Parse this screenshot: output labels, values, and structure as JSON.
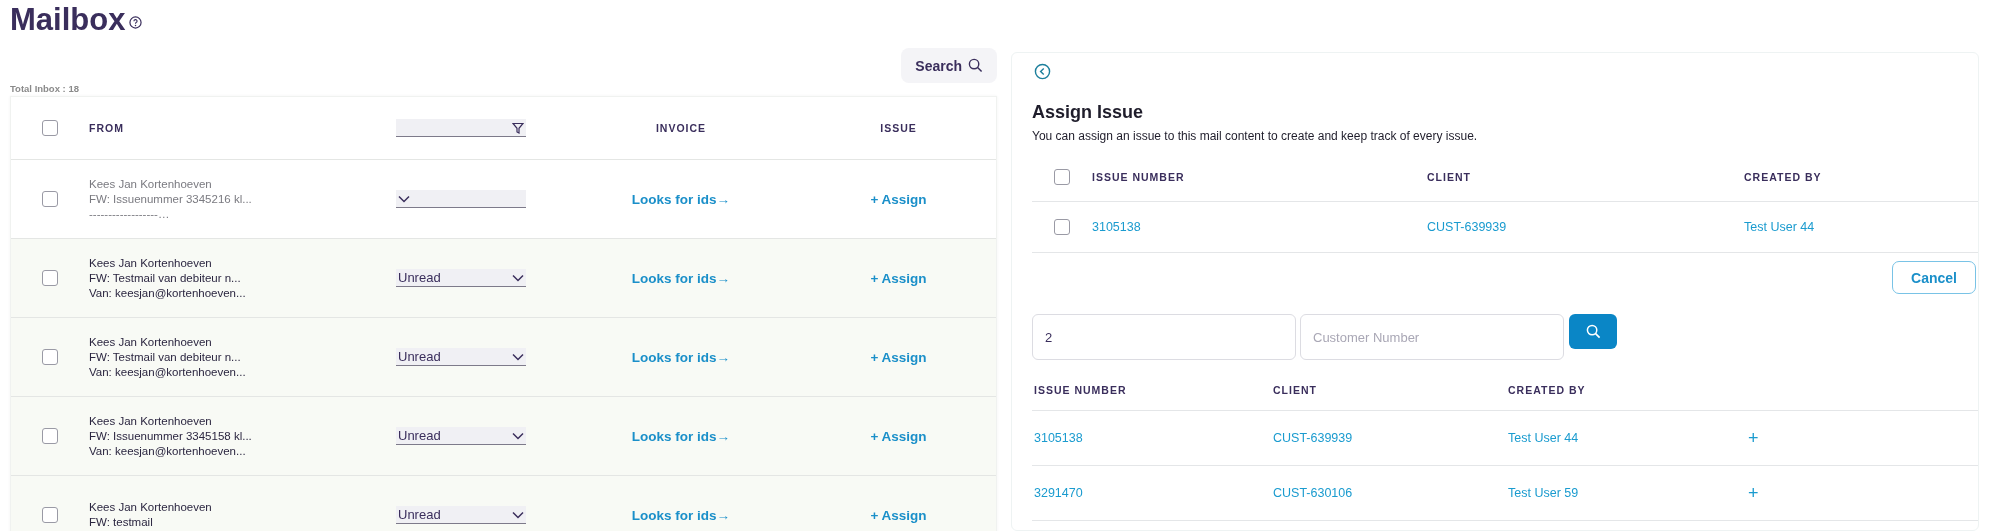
{
  "page": {
    "title": "Mailbox",
    "search_button": "Search",
    "total": "Total Inbox : 18"
  },
  "mail_table": {
    "header_checked": false,
    "columns": [
      "FROM",
      "INVOICE",
      "ISSUE"
    ],
    "rows": [
      {
        "checked": false,
        "muted": true,
        "sender": "Kees Jan Kortenhoeven",
        "subject": "FW: Issuenummer 3345216 kl...",
        "preview": "------------------…",
        "invoice_link": "Looks for ids→",
        "issue_link": "+ Assign"
      },
      {
        "checked": false,
        "muted": false,
        "sender": "Kees Jan Kortenhoeven",
        "subject": "FW: Testmail van debiteur n...",
        "preview": "Van: keesjan@kortenhoeven...",
        "status": "Unread",
        "invoice_link": "Looks for ids→",
        "issue_link": "+ Assign"
      },
      {
        "checked": false,
        "muted": false,
        "sender": "Kees Jan Kortenhoeven",
        "subject": "FW: Testmail van debiteur n...",
        "preview": "Van: keesjan@kortenhoeven...",
        "status": "Unread",
        "invoice_link": "Looks for ids→",
        "issue_link": "+ Assign"
      },
      {
        "checked": false,
        "muted": false,
        "sender": "Kees Jan Kortenhoeven",
        "subject": "FW: Issuenummer 3345158 kl...",
        "preview": "Van: keesjan@kortenhoeven...",
        "status": "Unread",
        "invoice_link": "Looks for ids→",
        "issue_link": "+ Assign"
      },
      {
        "checked": false,
        "muted": false,
        "sender": "Kees Jan Kortenhoeven",
        "subject": "FW: testmail",
        "status": "Unread",
        "invoice_link": "Looks for ids→",
        "issue_link": "+ Assign"
      }
    ]
  },
  "assign_panel": {
    "title": "Assign Issue",
    "description": "You can assign an issue to this mail content to create and keep track of every issue.",
    "selected_table": {
      "header_checked": false,
      "columns": [
        "ISSUE NUMBER",
        "CLIENT",
        "CREATED BY"
      ],
      "rows": [
        {
          "checked": false,
          "issue_number": "3105138",
          "client": "CUST-639939",
          "created_by": "Test User 44"
        }
      ]
    },
    "cancel_button": "Cancel",
    "issue_search": {
      "value": "2"
    },
    "customer_search": {
      "placeholder": "Customer Number"
    },
    "results": {
      "columns": [
        "ISSUE NUMBER",
        "CLIENT",
        "CREATED BY"
      ],
      "rows": [
        {
          "issue_number": "3105138",
          "client": "CUST-639939",
          "created_by": "Test User 44",
          "add": "+"
        },
        {
          "issue_number": "3291470",
          "client": "CUST-630106",
          "created_by": "Test User 59",
          "add": "+"
        }
      ]
    }
  }
}
